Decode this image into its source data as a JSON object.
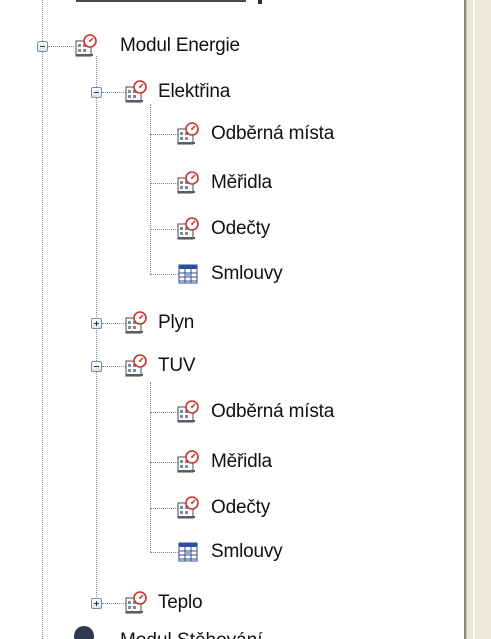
{
  "tree": {
    "modul_energie": "Modul Energie",
    "elektrina": {
      "label": "Elektřina",
      "children": [
        "Odběrná místa",
        "Měřidla",
        "Odečty",
        "Smlouvy"
      ]
    },
    "plyn": "Plyn",
    "tuv": {
      "label": "TUV",
      "children": [
        "Odběrná místa",
        "Měřidla",
        "Odečty",
        "Smlouvy"
      ]
    },
    "teplo": "Teplo",
    "bottom_partial": "Modul Stěhování"
  },
  "icons": {
    "module": "module-gauge-icon",
    "folder": "gauge-folder-icon",
    "item": "gauge-item-icon",
    "contracts": "table-grid-icon"
  },
  "colors": {
    "tree_line": "#8c8c8c",
    "toggle_border": "#7c8fa3",
    "gauge_red": "#c8352a",
    "grid_blue": "#2f4e9a",
    "panel_bg": "#ece9d8"
  }
}
